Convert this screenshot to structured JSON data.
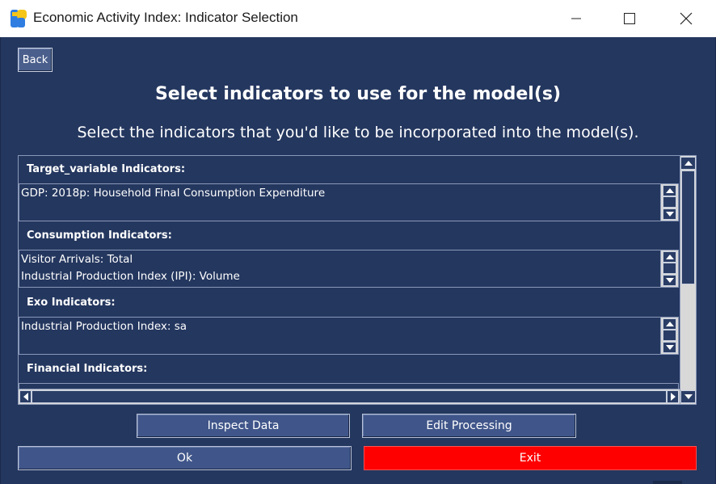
{
  "window": {
    "title": "Economic Activity Index: Indicator Selection"
  },
  "back_label": "Back",
  "heading": "Select indicators to use for the model(s)",
  "subheading": "Select the indicators that you'd like to be incorporated into the model(s).",
  "groups": [
    {
      "label": "Target_variable Indicators:",
      "items": [
        "GDP: 2018p: Household Final Consumption Expenditure"
      ]
    },
    {
      "label": "Consumption Indicators:",
      "items": [
        "Visitor Arrivals: Total",
        "Industrial Production Index (IPI): Volume"
      ]
    },
    {
      "label": "Exo Indicators:",
      "items": [
        "Industrial Production Index: sa"
      ]
    },
    {
      "label": "Financial Indicators:",
      "items": []
    }
  ],
  "buttons": {
    "inspect": "Inspect Data",
    "edit": "Edit Processing",
    "ok": "Ok",
    "exit": "Exit"
  },
  "colors": {
    "background": "#24375f",
    "button": "#40568a",
    "exit": "#ff0000"
  },
  "icons": {
    "app": "app-logo-icon",
    "minimize": "minimize-icon",
    "maximize": "maximize-icon",
    "close": "close-icon"
  }
}
